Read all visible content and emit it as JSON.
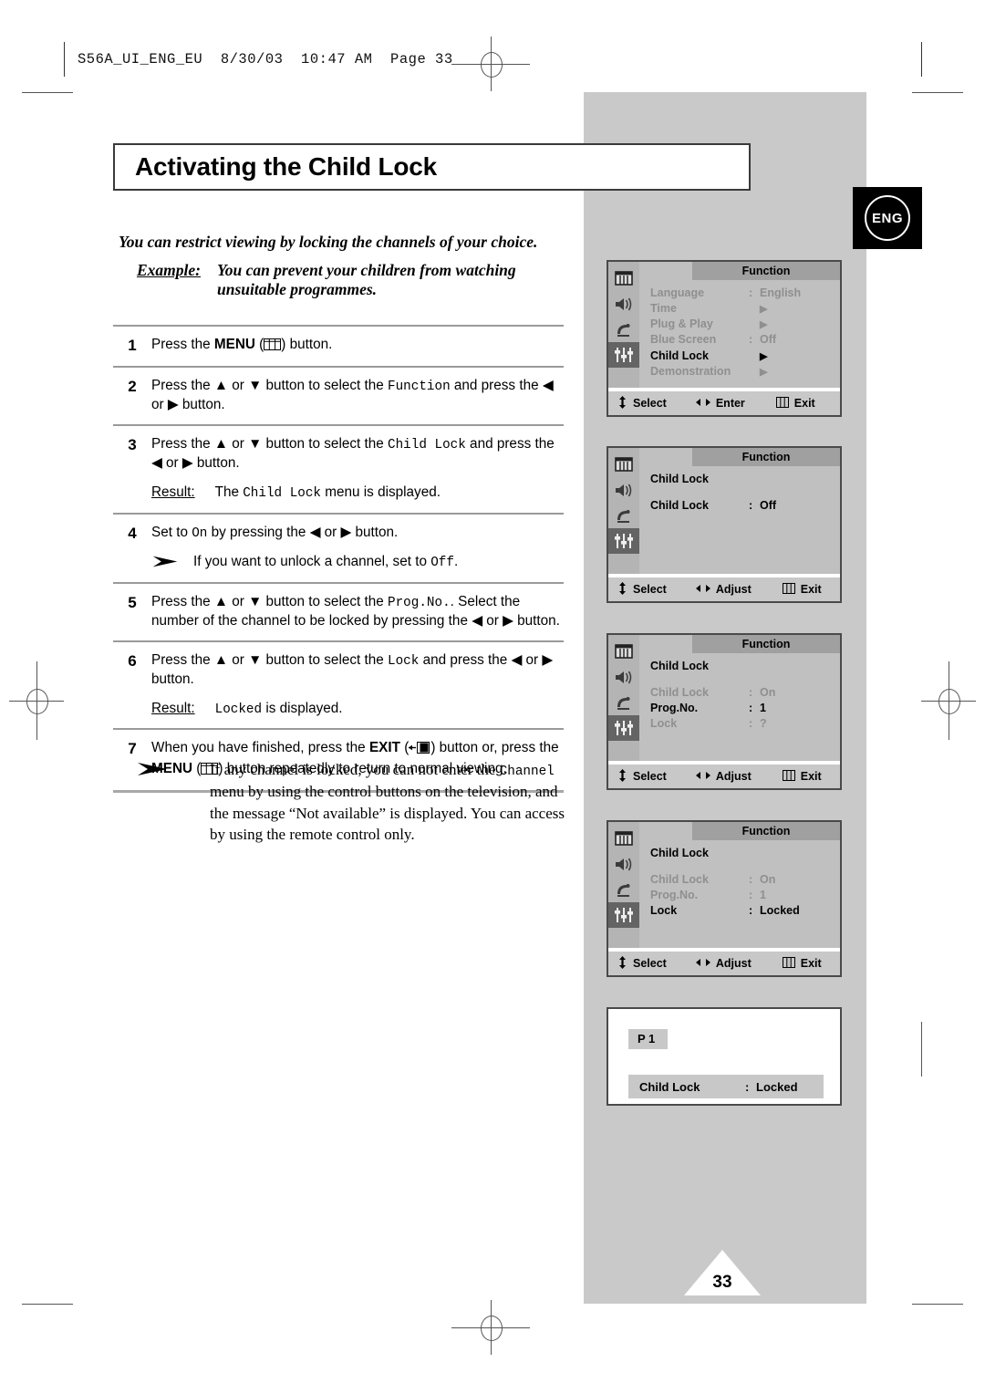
{
  "print": {
    "slug": "S56A_UI_ENG_EU  8/30/03  10:47 AM  Page 33",
    "page_number": "33",
    "lang_badge": "ENG"
  },
  "title": "Activating the Child Lock",
  "intro": {
    "lead": "You can restrict viewing by locking the channels of your choice.",
    "example_label": "Example:",
    "example_text": "You can prevent your children from watching unsuitable programmes."
  },
  "steps": [
    {
      "num": "1",
      "parts": [
        {
          "t": "plain",
          "v": "Press the "
        },
        {
          "t": "bold",
          "v": "MENU"
        },
        {
          "t": "plain",
          "v": " ("
        },
        {
          "t": "icon",
          "v": "menu-glyph"
        },
        {
          "t": "plain",
          "v": ") button."
        }
      ]
    },
    {
      "num": "2",
      "parts": [
        {
          "t": "plain",
          "v": "Press the ▲ or ▼ button to select the "
        },
        {
          "t": "mono",
          "v": "Function"
        },
        {
          "t": "plain",
          "v": " and press the ◀ or ▶ button."
        }
      ]
    },
    {
      "num": "3",
      "parts": [
        {
          "t": "plain",
          "v": "Press the ▲ or ▼ button to select the "
        },
        {
          "t": "mono",
          "v": "Child Lock"
        },
        {
          "t": "plain",
          "v": " and press the ◀ or ▶ button."
        }
      ],
      "result_label": "Result:",
      "result_parts": [
        {
          "t": "plain",
          "v": "The "
        },
        {
          "t": "mono",
          "v": "Child Lock"
        },
        {
          "t": "plain",
          "v": " menu is displayed."
        }
      ]
    },
    {
      "num": "4",
      "parts": [
        {
          "t": "plain",
          "v": "Set to "
        },
        {
          "t": "mono",
          "v": "On"
        },
        {
          "t": "plain",
          "v": " by pressing the ◀ or ▶ button."
        }
      ],
      "note_parts": [
        {
          "t": "plain",
          "v": "If you want to unlock a channel, set to "
        },
        {
          "t": "mono",
          "v": "Off"
        },
        {
          "t": "plain",
          "v": "."
        }
      ]
    },
    {
      "num": "5",
      "parts": [
        {
          "t": "plain",
          "v": "Press the ▲ or ▼ button to select the "
        },
        {
          "t": "mono",
          "v": "Prog.No."
        },
        {
          "t": "plain",
          "v": ". Select the number of the channel to be locked by pressing the ◀ or ▶ button."
        }
      ]
    },
    {
      "num": "6",
      "parts": [
        {
          "t": "plain",
          "v": "Press the ▲ or ▼ button to select the "
        },
        {
          "t": "mono",
          "v": "Lock"
        },
        {
          "t": "plain",
          "v": " and press the ◀ or ▶ button."
        }
      ],
      "result_label": "Result:",
      "result_parts": [
        {
          "t": "mono",
          "v": "Locked"
        },
        {
          "t": "plain",
          "v": " is displayed."
        }
      ]
    },
    {
      "num": "7",
      "parts": [
        {
          "t": "plain",
          "v": "When you have finished, press the "
        },
        {
          "t": "bold",
          "v": "EXIT"
        },
        {
          "t": "plain",
          "v": " ("
        },
        {
          "t": "icon",
          "v": "exit-glyph"
        },
        {
          "t": "plain",
          "v": ") button or, press the "
        },
        {
          "t": "bold",
          "v": "MENU"
        },
        {
          "t": "plain",
          "v": " ("
        },
        {
          "t": "icon",
          "v": "menu-glyph"
        },
        {
          "t": "plain",
          "v": ") button repeatedly to return to normal viewing."
        }
      ]
    }
  ],
  "bottom_note_parts": [
    {
      "t": "plain",
      "v": "If any channel is locked, you can not enter the "
    },
    {
      "t": "mono",
      "v": "Channel"
    },
    {
      "t": "plain",
      "v": " menu by using the control buttons on the television, and the message “Not available” is displayed. You can access by using the remote control only."
    }
  ],
  "osd_footer_variants": {
    "enter": [
      {
        "glyph": "updown-arrow-icon",
        "label": "Select"
      },
      {
        "glyph": "leftright-arrow-icon",
        "label": "Enter"
      },
      {
        "glyph": "menu-bars-icon",
        "label": "Exit"
      }
    ],
    "adjust": [
      {
        "glyph": "updown-arrow-icon",
        "label": "Select"
      },
      {
        "glyph": "leftright-arrow-icon",
        "label": "Adjust"
      },
      {
        "glyph": "menu-bars-icon",
        "label": "Exit"
      }
    ]
  },
  "osd_panels": [
    {
      "id": "function-menu",
      "title": "Function",
      "footer": "enter",
      "rows": [
        {
          "label": "Language",
          "sep": ":",
          "value": "English",
          "state": "dim"
        },
        {
          "label": "Time",
          "sep": "",
          "value": "▶",
          "state": "dim"
        },
        {
          "label": "Plug & Play",
          "sep": "",
          "value": "▶",
          "state": "dim"
        },
        {
          "label": "Blue Screen",
          "sep": ":",
          "value": "Off",
          "state": "dim"
        },
        {
          "label": "Child Lock",
          "sep": "",
          "value": "▶",
          "state": "active"
        },
        {
          "label": "Demonstration",
          "sep": "",
          "value": "▶",
          "state": "dim"
        }
      ]
    },
    {
      "id": "child-lock-off",
      "title": "Function",
      "footer": "adjust",
      "rows": [
        {
          "label": "Child Lock",
          "sep": "",
          "value": "",
          "state": "active"
        },
        {
          "label": "",
          "sep": "",
          "value": "",
          "state": "gap"
        },
        {
          "label": "Child Lock",
          "sep": ":",
          "value": "Off",
          "state": "active"
        }
      ]
    },
    {
      "id": "child-lock-prog-no",
      "title": "Function",
      "footer": "adjust",
      "rows": [
        {
          "label": "Child Lock",
          "sep": "",
          "value": "",
          "state": "active"
        },
        {
          "label": "",
          "sep": "",
          "value": "",
          "state": "gap"
        },
        {
          "label": "Child Lock",
          "sep": ":",
          "value": "On",
          "state": "dim"
        },
        {
          "label": "Prog.No.",
          "sep": ":",
          "value": "1",
          "state": "active"
        },
        {
          "label": "Lock",
          "sep": ":",
          "value": "?",
          "state": "dim"
        }
      ]
    },
    {
      "id": "child-lock-locked",
      "title": "Function",
      "footer": "adjust",
      "rows": [
        {
          "label": "Child Lock",
          "sep": "",
          "value": "",
          "state": "active"
        },
        {
          "label": "",
          "sep": "",
          "value": "",
          "state": "gap"
        },
        {
          "label": "Child Lock",
          "sep": ":",
          "value": "On",
          "state": "dim"
        },
        {
          "label": "Prog.No.",
          "sep": ":",
          "value": "1",
          "state": "dim"
        },
        {
          "label": "Lock",
          "sep": ":",
          "value": "Locked",
          "state": "active"
        }
      ]
    }
  ],
  "osd_banner": {
    "id": "tv-banner",
    "program": "P 1",
    "label": "Child Lock",
    "sep": ":",
    "value": "Locked"
  },
  "colors": {
    "sidebar_gray": "#c9c9c9",
    "osd_menu_bg": "#c0c0c0",
    "osd_titlebar": "#a0a0a0",
    "osd_footer": "#c8c8c8",
    "osd_icon_col": "#b4b4b4",
    "osd_icon_selected": "#646464",
    "dim_text": "#8f8f8f"
  }
}
